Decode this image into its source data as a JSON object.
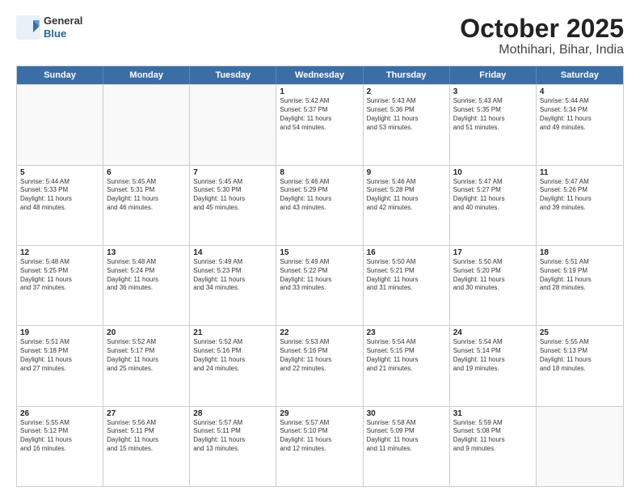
{
  "logo": {
    "general": "General",
    "blue": "Blue"
  },
  "title": "October 2025",
  "subtitle": "Mothihari, Bihar, India",
  "header_days": [
    "Sunday",
    "Monday",
    "Tuesday",
    "Wednesday",
    "Thursday",
    "Friday",
    "Saturday"
  ],
  "rows": [
    [
      {
        "day": "",
        "lines": []
      },
      {
        "day": "",
        "lines": []
      },
      {
        "day": "",
        "lines": []
      },
      {
        "day": "1",
        "lines": [
          "Sunrise: 5:42 AM",
          "Sunset: 5:37 PM",
          "Daylight: 11 hours",
          "and 54 minutes."
        ]
      },
      {
        "day": "2",
        "lines": [
          "Sunrise: 5:43 AM",
          "Sunset: 5:36 PM",
          "Daylight: 11 hours",
          "and 53 minutes."
        ]
      },
      {
        "day": "3",
        "lines": [
          "Sunrise: 5:43 AM",
          "Sunset: 5:35 PM",
          "Daylight: 11 hours",
          "and 51 minutes."
        ]
      },
      {
        "day": "4",
        "lines": [
          "Sunrise: 5:44 AM",
          "Sunset: 5:34 PM",
          "Daylight: 11 hours",
          "and 49 minutes."
        ]
      }
    ],
    [
      {
        "day": "5",
        "lines": [
          "Sunrise: 5:44 AM",
          "Sunset: 5:33 PM",
          "Daylight: 11 hours",
          "and 48 minutes."
        ]
      },
      {
        "day": "6",
        "lines": [
          "Sunrise: 5:45 AM",
          "Sunset: 5:31 PM",
          "Daylight: 11 hours",
          "and 46 minutes."
        ]
      },
      {
        "day": "7",
        "lines": [
          "Sunrise: 5:45 AM",
          "Sunset: 5:30 PM",
          "Daylight: 11 hours",
          "and 45 minutes."
        ]
      },
      {
        "day": "8",
        "lines": [
          "Sunrise: 5:46 AM",
          "Sunset: 5:29 PM",
          "Daylight: 11 hours",
          "and 43 minutes."
        ]
      },
      {
        "day": "9",
        "lines": [
          "Sunrise: 5:46 AM",
          "Sunset: 5:28 PM",
          "Daylight: 11 hours",
          "and 42 minutes."
        ]
      },
      {
        "day": "10",
        "lines": [
          "Sunrise: 5:47 AM",
          "Sunset: 5:27 PM",
          "Daylight: 11 hours",
          "and 40 minutes."
        ]
      },
      {
        "day": "11",
        "lines": [
          "Sunrise: 5:47 AM",
          "Sunset: 5:26 PM",
          "Daylight: 11 hours",
          "and 39 minutes."
        ]
      }
    ],
    [
      {
        "day": "12",
        "lines": [
          "Sunrise: 5:48 AM",
          "Sunset: 5:25 PM",
          "Daylight: 11 hours",
          "and 37 minutes."
        ]
      },
      {
        "day": "13",
        "lines": [
          "Sunrise: 5:48 AM",
          "Sunset: 5:24 PM",
          "Daylight: 11 hours",
          "and 36 minutes."
        ]
      },
      {
        "day": "14",
        "lines": [
          "Sunrise: 5:49 AM",
          "Sunset: 5:23 PM",
          "Daylight: 11 hours",
          "and 34 minutes."
        ]
      },
      {
        "day": "15",
        "lines": [
          "Sunrise: 5:49 AM",
          "Sunset: 5:22 PM",
          "Daylight: 11 hours",
          "and 33 minutes."
        ]
      },
      {
        "day": "16",
        "lines": [
          "Sunrise: 5:50 AM",
          "Sunset: 5:21 PM",
          "Daylight: 11 hours",
          "and 31 minutes."
        ]
      },
      {
        "day": "17",
        "lines": [
          "Sunrise: 5:50 AM",
          "Sunset: 5:20 PM",
          "Daylight: 11 hours",
          "and 30 minutes."
        ]
      },
      {
        "day": "18",
        "lines": [
          "Sunrise: 5:51 AM",
          "Sunset: 5:19 PM",
          "Daylight: 11 hours",
          "and 28 minutes."
        ]
      }
    ],
    [
      {
        "day": "19",
        "lines": [
          "Sunrise: 5:51 AM",
          "Sunset: 5:18 PM",
          "Daylight: 11 hours",
          "and 27 minutes."
        ]
      },
      {
        "day": "20",
        "lines": [
          "Sunrise: 5:52 AM",
          "Sunset: 5:17 PM",
          "Daylight: 11 hours",
          "and 25 minutes."
        ]
      },
      {
        "day": "21",
        "lines": [
          "Sunrise: 5:52 AM",
          "Sunset: 5:16 PM",
          "Daylight: 11 hours",
          "and 24 minutes."
        ]
      },
      {
        "day": "22",
        "lines": [
          "Sunrise: 5:53 AM",
          "Sunset: 5:16 PM",
          "Daylight: 11 hours",
          "and 22 minutes."
        ]
      },
      {
        "day": "23",
        "lines": [
          "Sunrise: 5:54 AM",
          "Sunset: 5:15 PM",
          "Daylight: 11 hours",
          "and 21 minutes."
        ]
      },
      {
        "day": "24",
        "lines": [
          "Sunrise: 5:54 AM",
          "Sunset: 5:14 PM",
          "Daylight: 11 hours",
          "and 19 minutes."
        ]
      },
      {
        "day": "25",
        "lines": [
          "Sunrise: 5:55 AM",
          "Sunset: 5:13 PM",
          "Daylight: 11 hours",
          "and 18 minutes."
        ]
      }
    ],
    [
      {
        "day": "26",
        "lines": [
          "Sunrise: 5:55 AM",
          "Sunset: 5:12 PM",
          "Daylight: 11 hours",
          "and 16 minutes."
        ]
      },
      {
        "day": "27",
        "lines": [
          "Sunrise: 5:56 AM",
          "Sunset: 5:11 PM",
          "Daylight: 11 hours",
          "and 15 minutes."
        ]
      },
      {
        "day": "28",
        "lines": [
          "Sunrise: 5:57 AM",
          "Sunset: 5:11 PM",
          "Daylight: 11 hours",
          "and 13 minutes."
        ]
      },
      {
        "day": "29",
        "lines": [
          "Sunrise: 5:57 AM",
          "Sunset: 5:10 PM",
          "Daylight: 11 hours",
          "and 12 minutes."
        ]
      },
      {
        "day": "30",
        "lines": [
          "Sunrise: 5:58 AM",
          "Sunset: 5:09 PM",
          "Daylight: 11 hours",
          "and 11 minutes."
        ]
      },
      {
        "day": "31",
        "lines": [
          "Sunrise: 5:59 AM",
          "Sunset: 5:08 PM",
          "Daylight: 11 hours",
          "and 9 minutes."
        ]
      },
      {
        "day": "",
        "lines": []
      }
    ]
  ]
}
